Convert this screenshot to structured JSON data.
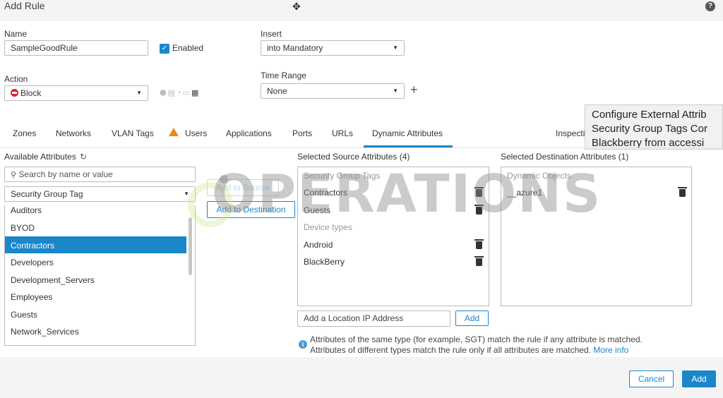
{
  "dialog": {
    "title": "Add Rule"
  },
  "form": {
    "name_label": "Name",
    "name_value": "SampleGoodRule",
    "enabled_label": "Enabled",
    "insert_label": "Insert",
    "insert_value": "into Mandatory",
    "action_label": "Action",
    "action_value": "Block",
    "time_range_label": "Time Range",
    "time_range_value": "None"
  },
  "tooltip": {
    "lines": [
      "Configure External Attrib",
      "Security Group Tags Cor",
      "Blackberry from accessi"
    ]
  },
  "tabs": [
    {
      "label": "Zones"
    },
    {
      "label": "Networks"
    },
    {
      "label": "VLAN Tags"
    },
    {
      "label": "Users"
    },
    {
      "label": "Applications"
    },
    {
      "label": "Ports"
    },
    {
      "label": "URLs"
    },
    {
      "label": "Dynamic Attributes"
    },
    {
      "label": "Inspecti"
    }
  ],
  "available": {
    "title": "Available Attributes",
    "search_placeholder": "Search by name or value",
    "type_value": "Security Group Tag",
    "items": [
      "Auditors",
      "BYOD",
      "Contractors",
      "Developers",
      "Development_Servers",
      "Employees",
      "Guests",
      "Network_Services"
    ],
    "selected_item": "Contractors"
  },
  "buttons": {
    "add_to_source": "Add to Source",
    "add_to_destination": "Add to Destination",
    "add_location": "Add",
    "cancel": "Cancel",
    "add": "Add"
  },
  "source": {
    "title": "Selected Source Attributes (4)",
    "group1": "Security Group Tags",
    "group1_items": [
      "Contractors",
      "Guests"
    ],
    "group2": "Device types",
    "group2_items": [
      "Android",
      "BlackBerry"
    ],
    "location_placeholder": "Add a Location IP Address"
  },
  "destination": {
    "title": "Selected Destination Attributes (1)",
    "group1": "Dynamic Objects",
    "group1_items": [
      "__azure1"
    ]
  },
  "info": {
    "line1": "Attributes of the same type (for example, SGT) match the rule if any attribute is matched.",
    "line2": "Attributes of different types match the rule only if all attributes are matched.",
    "more_link": "More info"
  },
  "watermark": {
    "text": "OPERATIONS"
  },
  "colors": {
    "accent": "#1a87c9",
    "block": "#d9232e",
    "warning": "#e8891b"
  }
}
